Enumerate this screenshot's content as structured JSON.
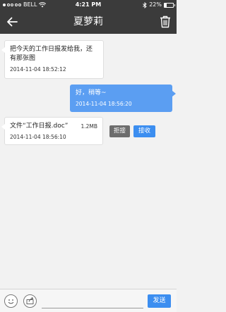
{
  "status_bar": {
    "carrier": "BELL",
    "time": "4:21 PM",
    "battery_percent": "22%",
    "battery_level": 0.22
  },
  "nav": {
    "title": "夏萝莉",
    "back_icon": "back-arrow-icon",
    "trash_icon": "trash-icon"
  },
  "messages": [
    {
      "direction": "incoming",
      "text_line1": "把今天的工作日报发给我，还",
      "text_line2": "有那张图",
      "time": "2014-11-04 18:52:12"
    },
    {
      "direction": "outgoing",
      "text": "好，稍等~",
      "time": "2014-11-04 18:56:20"
    },
    {
      "direction": "incoming",
      "type": "file",
      "file_label": "文件“工作日报.doc”",
      "file_size": "1.2MB",
      "time": "2014-11-04 18:56:10",
      "reject_label": "拒接",
      "accept_label": "接收"
    }
  ],
  "input_bar": {
    "emoji_icon": "emoji-icon",
    "share_icon": "share-icon",
    "input_value": "",
    "send_label": "发送"
  },
  "colors": {
    "bar_bg": "#3b3b3b",
    "outgoing_bubble": "#5b9ef2",
    "accept_button": "#3c8ef0",
    "reject_button": "#6d6d6d"
  }
}
